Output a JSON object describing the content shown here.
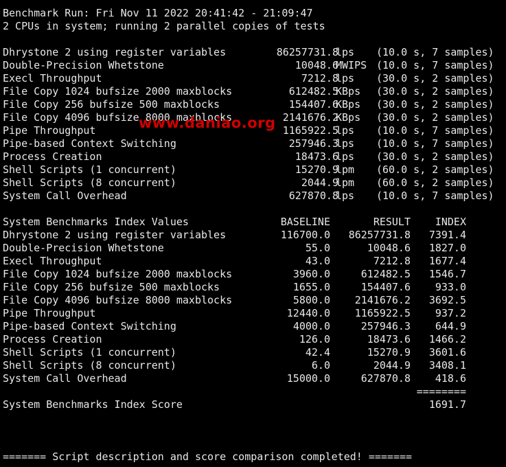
{
  "terminal": {
    "top_rule": "------------------------------------------------------------------------",
    "header": {
      "run": "Benchmark Run: Fri Nov 11 2022 20:41:42 - 21:09:47",
      "cpus": "2 CPUs in system; running 2 parallel copies of tests"
    },
    "results": [
      {
        "name": "Dhrystone 2 using register variables",
        "value": "86257731.8",
        "unit": "lps",
        "info": "(10.0 s, 7 samples)"
      },
      {
        "name": "Double-Precision Whetstone",
        "value": "10048.6",
        "unit": "MWIPS",
        "info": "(10.0 s, 7 samples)"
      },
      {
        "name": "Execl Throughput",
        "value": "7212.8",
        "unit": "lps",
        "info": "(30.0 s, 2 samples)"
      },
      {
        "name": "File Copy 1024 bufsize 2000 maxblocks",
        "value": "612482.5",
        "unit": "KBps",
        "info": "(30.0 s, 2 samples)"
      },
      {
        "name": "File Copy 256 bufsize 500 maxblocks",
        "value": "154407.6",
        "unit": "KBps",
        "info": "(30.0 s, 2 samples)"
      },
      {
        "name": "File Copy 4096 bufsize 8000 maxblocks",
        "value": "2141676.2",
        "unit": "KBps",
        "info": "(30.0 s, 2 samples)"
      },
      {
        "name": "Pipe Throughput",
        "value": "1165922.5",
        "unit": "lps",
        "info": "(10.0 s, 7 samples)"
      },
      {
        "name": "Pipe-based Context Switching",
        "value": "257946.3",
        "unit": "lps",
        "info": "(10.0 s, 7 samples)"
      },
      {
        "name": "Process Creation",
        "value": "18473.6",
        "unit": "lps",
        "info": "(30.0 s, 2 samples)"
      },
      {
        "name": "Shell Scripts (1 concurrent)",
        "value": "15270.9",
        "unit": "lpm",
        "info": "(60.0 s, 2 samples)"
      },
      {
        "name": "Shell Scripts (8 concurrent)",
        "value": "2044.9",
        "unit": "lpm",
        "info": "(60.0 s, 2 samples)"
      },
      {
        "name": "System Call Overhead",
        "value": "627870.8",
        "unit": "lps",
        "info": "(10.0 s, 7 samples)"
      }
    ],
    "index_table": {
      "title": "System Benchmarks Index Values",
      "col_baseline": "BASELINE",
      "col_result": "RESULT",
      "col_index": "INDEX",
      "rows": [
        {
          "name": "Dhrystone 2 using register variables",
          "baseline": "116700.0",
          "result": "86257731.8",
          "index": "7391.4"
        },
        {
          "name": "Double-Precision Whetstone",
          "baseline": "55.0",
          "result": "10048.6",
          "index": "1827.0"
        },
        {
          "name": "Execl Throughput",
          "baseline": "43.0",
          "result": "7212.8",
          "index": "1677.4"
        },
        {
          "name": "File Copy 1024 bufsize 2000 maxblocks",
          "baseline": "3960.0",
          "result": "612482.5",
          "index": "1546.7"
        },
        {
          "name": "File Copy 256 bufsize 500 maxblocks",
          "baseline": "1655.0",
          "result": "154407.6",
          "index": "933.0"
        },
        {
          "name": "File Copy 4096 bufsize 8000 maxblocks",
          "baseline": "5800.0",
          "result": "2141676.2",
          "index": "3692.5"
        },
        {
          "name": "Pipe Throughput",
          "baseline": "12440.0",
          "result": "1165922.5",
          "index": "937.2"
        },
        {
          "name": "Pipe-based Context Switching",
          "baseline": "4000.0",
          "result": "257946.3",
          "index": "644.9"
        },
        {
          "name": "Process Creation",
          "baseline": "126.0",
          "result": "18473.6",
          "index": "1466.2"
        },
        {
          "name": "Shell Scripts (1 concurrent)",
          "baseline": "42.4",
          "result": "15270.9",
          "index": "3601.6"
        },
        {
          "name": "Shell Scripts (8 concurrent)",
          "baseline": "6.0",
          "result": "2044.9",
          "index": "3408.1"
        },
        {
          "name": "System Call Overhead",
          "baseline": "15000.0",
          "result": "627870.8",
          "index": "418.6"
        }
      ],
      "separator": "========",
      "score_label": "System Benchmarks Index Score",
      "score_value": "1691.7"
    },
    "footer": "======= Script description and score comparison completed! ======="
  },
  "watermark": {
    "text": "www.daniao.org",
    "color": "#d00000"
  }
}
